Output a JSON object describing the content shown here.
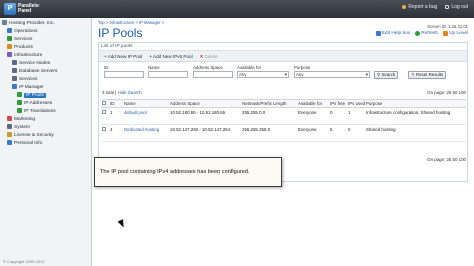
{
  "brand": {
    "logo_mark": "P",
    "name_line1": "Parallels·",
    "name_line2": "Panel"
  },
  "topbar": {
    "report_bug": "Report a bug",
    "logout": "Log out"
  },
  "sidebar": {
    "items": [
      {
        "label": "Hosting Provider, Inc.",
        "indent": 0,
        "color": "#6f7f93"
      },
      {
        "label": "Operations",
        "indent": 1,
        "color": "#3c78c8"
      },
      {
        "label": "Services",
        "indent": 1,
        "color": "#2e9a3c"
      },
      {
        "label": "Products",
        "indent": 1,
        "color": "#e08a1e"
      },
      {
        "label": "Infrastructure",
        "indent": 1,
        "color": "#7b5cc4"
      },
      {
        "label": "Service Nodes",
        "indent": 2,
        "color": "#5b6b80"
      },
      {
        "label": "Database Servers",
        "indent": 2,
        "color": "#5b6b80"
      },
      {
        "label": "Services",
        "indent": 2,
        "color": "#5b6b80"
      },
      {
        "label": "IP Manager",
        "indent": 2,
        "color": "#3c78c8"
      },
      {
        "label": "IP Pools",
        "indent": 3,
        "color": "#2e9a3c",
        "active": true
      },
      {
        "label": "IP Addresses",
        "indent": 3,
        "color": "#2e9a3c"
      },
      {
        "label": "IP Translations",
        "indent": 3,
        "color": "#2e9a3c"
      },
      {
        "label": "Marketing",
        "indent": 1,
        "color": "#d04a4a"
      },
      {
        "label": "System",
        "indent": 1,
        "color": "#5b6b80"
      },
      {
        "label": "License & Security",
        "indent": 1,
        "color": "#c89a2a"
      },
      {
        "label": "Personal Info",
        "indent": 1,
        "color": "#3c78c8"
      }
    ],
    "copyright": "© Copyright 1999-2012"
  },
  "breadcrumb": "Top > Infrastructure > IP Manager >",
  "screen_id": "Screen ID: 1.15.31.01",
  "page_title": "IP Pools",
  "title_tools": {
    "edit_help": "Edit Help box",
    "refresh": "Refresh",
    "up_level": "Up Level"
  },
  "panel": {
    "header": "List of IP pools",
    "toolbar": {
      "add_ipv4": "Add New IP Pool",
      "add_ipv6": "Add New IPv6 Pool",
      "delete": "Delete"
    },
    "filters": {
      "id_label": "ID",
      "name_label": "Name",
      "address_space_label": "Address Space",
      "available_for_label": "Available for",
      "purpose_label": "Purpose",
      "available_for_value": "Any",
      "purpose_value": "Any",
      "search_button": "Search",
      "reset_button": "Reset Results"
    },
    "list_summary": "3 total",
    "hide_search": "Hide Search",
    "pager": "On page: 25 50 100",
    "columns": [
      "ID",
      "Name",
      "Address Space",
      "Netmask/Prefix Length",
      "Available for",
      "IPs free",
      "IPs used",
      "Purpose"
    ],
    "rows": [
      {
        "id": "1",
        "name": "default pool",
        "space": "10.52.180.65 - 10.52.180.65",
        "netmask": "255.255.0.0",
        "available": "Everyone",
        "free": "0",
        "used": "1",
        "purpose": "Infrastructure configuration, Shared hosting"
      },
      {
        "id": "4",
        "name": "Dedicated hosting",
        "space": "10.52.147.250 - 10.52.147.254",
        "netmask": "255.255.255.0",
        "available": "Everyone",
        "free": "5",
        "used": "0",
        "purpose": "Shared hosting"
      }
    ]
  },
  "callout": {
    "text": "The IP pool containing IPv4 addresses has been configured."
  }
}
